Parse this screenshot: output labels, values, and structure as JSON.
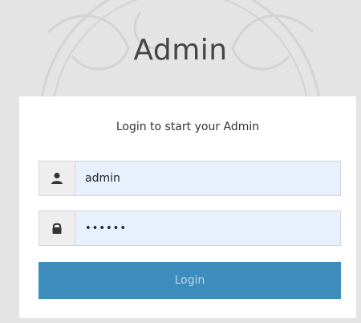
{
  "app": {
    "title": "Admin"
  },
  "login": {
    "message": "Login to start your Admin",
    "username_value": "admin",
    "password_value": "••••••",
    "button_label": "Login"
  },
  "icons": {
    "username": "user-icon",
    "password": "lock-icon"
  },
  "colors": {
    "background": "#e4e4e4",
    "panel": "#ffffff",
    "button": "#3c8dbc",
    "autofill": "#e8f0fe"
  }
}
